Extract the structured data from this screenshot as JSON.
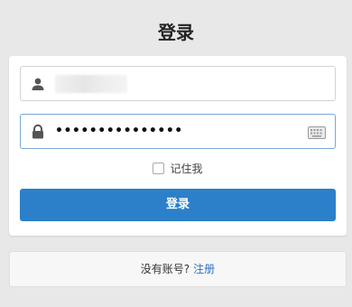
{
  "page": {
    "title": "登录"
  },
  "form": {
    "username": {
      "value": ""
    },
    "password": {
      "masked_value": "•••••••••••••••"
    },
    "remember_label": "记住我",
    "login_button": "登录"
  },
  "footer": {
    "no_account_text": "没有账号?",
    "register_link": "注册"
  },
  "colors": {
    "primary": "#2b80c9",
    "link": "#2b72c2",
    "background": "#e8e8e8"
  },
  "icons": [
    "user-icon",
    "lock-icon",
    "keyboard-icon"
  ]
}
